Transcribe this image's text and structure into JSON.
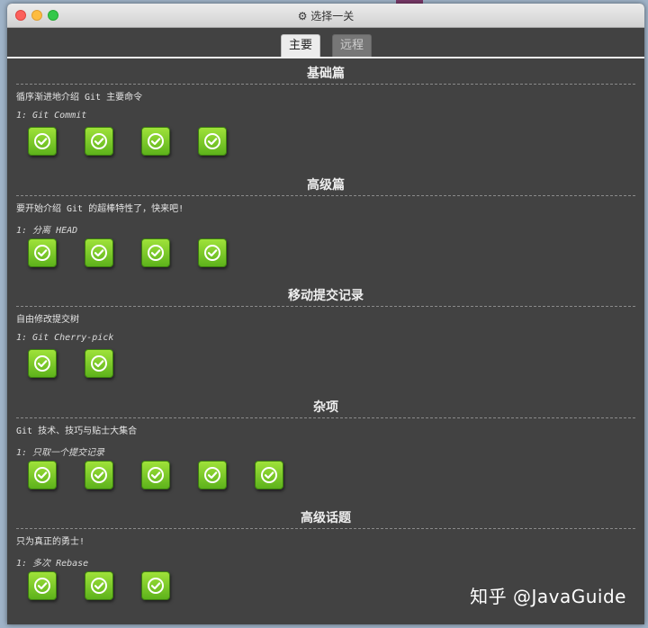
{
  "window": {
    "title": "⚙ 选择一关",
    "tabs": [
      {
        "label": "主要",
        "active": true
      },
      {
        "label": "远程",
        "active": false
      }
    ]
  },
  "sections": [
    {
      "title": "基础篇",
      "description": "循序渐进地介绍 Git 主要命令",
      "first_level": "1: Git Commit",
      "completed_levels": 4
    },
    {
      "title": "高级篇",
      "description": "要开始介绍 Git 的超棒特性了，快来吧!",
      "first_level": "1: 分离 HEAD",
      "completed_levels": 4
    },
    {
      "title": "移动提交记录",
      "description": "自由修改提交树",
      "first_level": "1: Git Cherry-pick",
      "completed_levels": 2
    },
    {
      "title": "杂项",
      "description": "Git 技术、技巧与贴士大集合",
      "first_level": "1: 只取一个提交记录",
      "completed_levels": 5
    },
    {
      "title": "高级话题",
      "description": "只为真正的勇士!",
      "first_level": "1: 多次 Rebase",
      "completed_levels": 3
    }
  ],
  "icons": {
    "level_complete": "checkmark-icon"
  },
  "colors": {
    "check_green": "#7ccf2a",
    "background": "#424242"
  },
  "watermark": "知乎 @JavaGuide"
}
